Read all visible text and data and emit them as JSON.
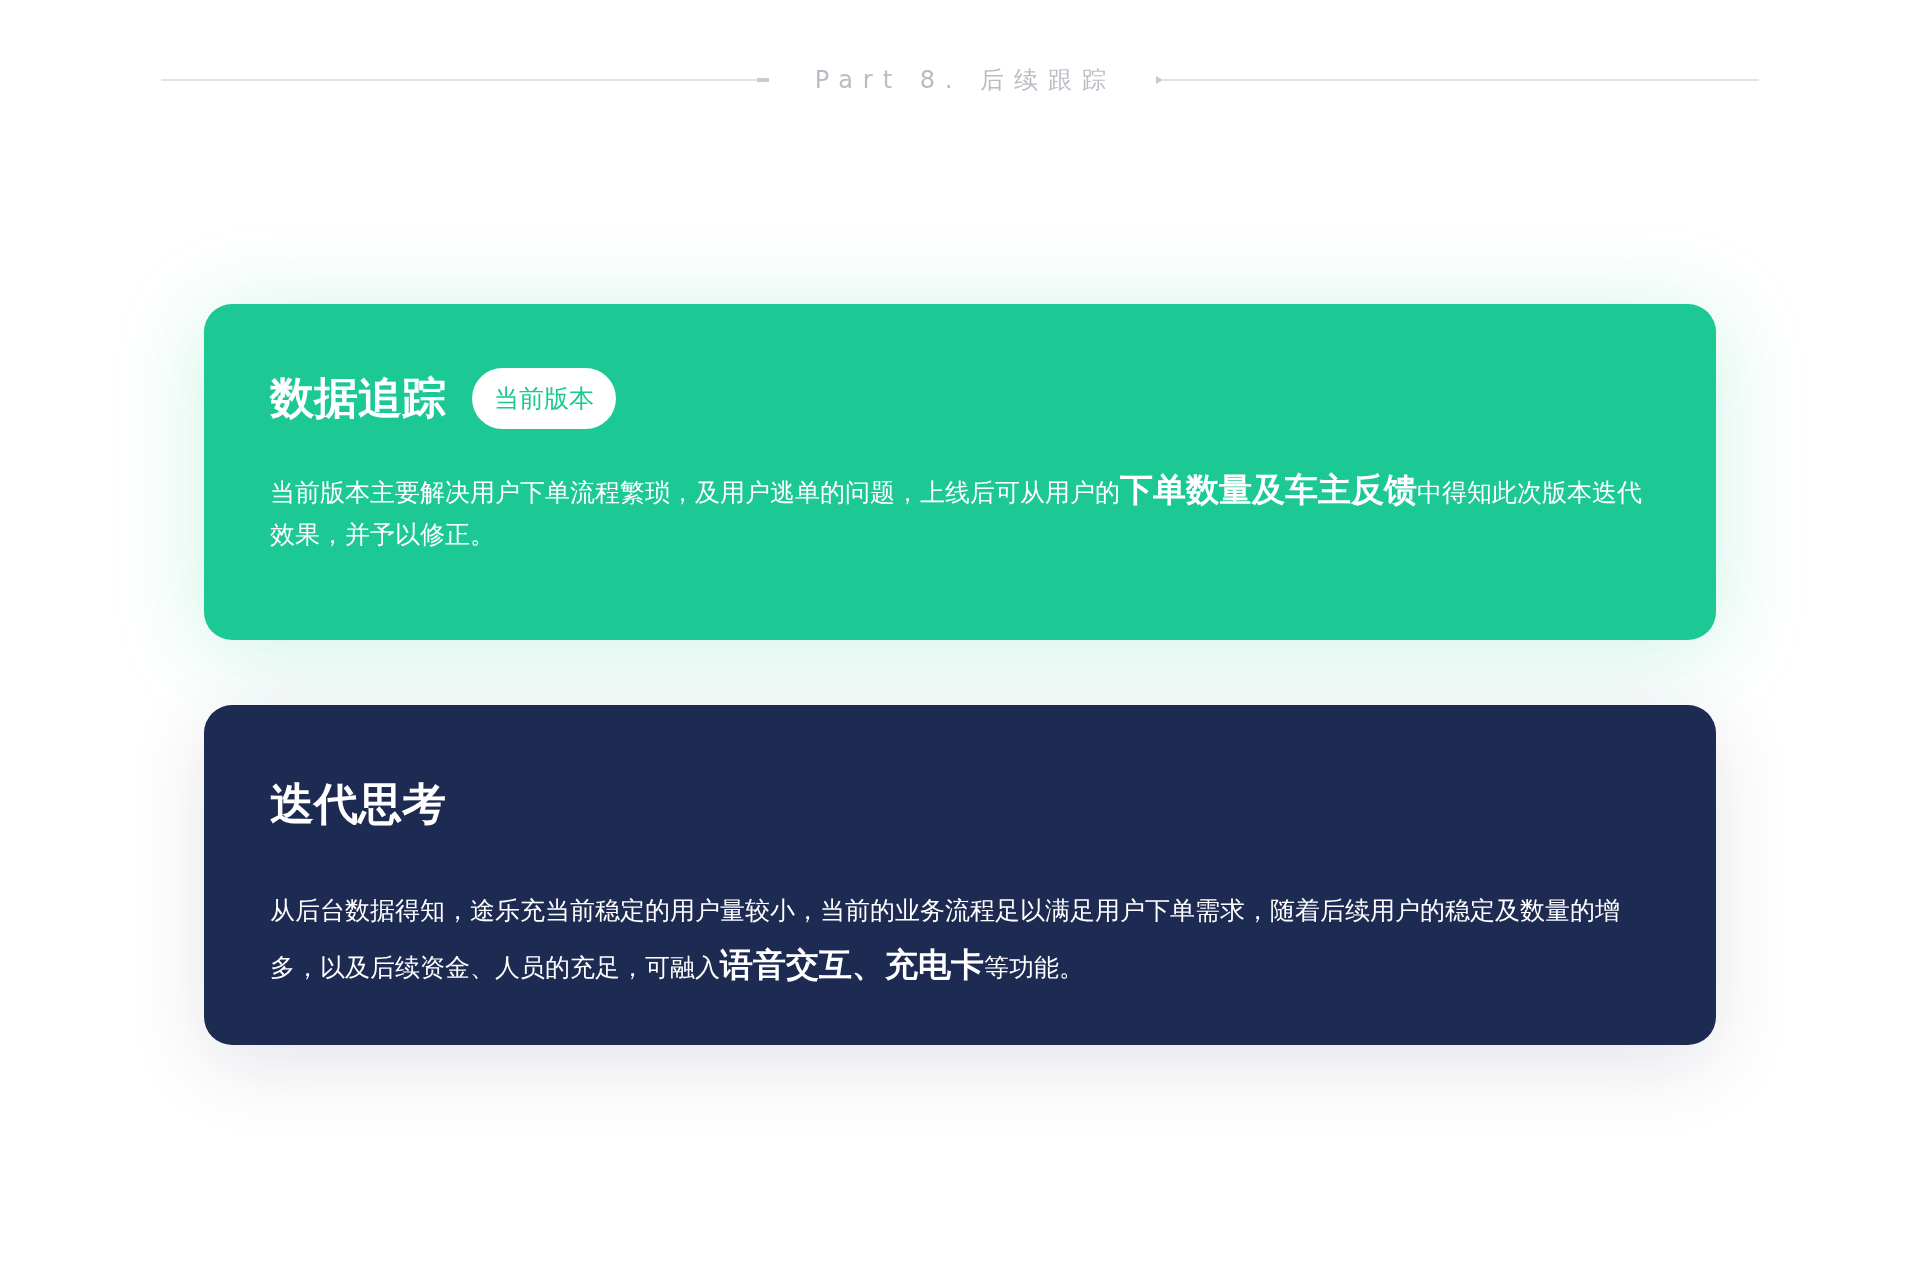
{
  "header": {
    "title": "Part 8. 后续跟踪"
  },
  "cards": [
    {
      "kind": "accent",
      "title": "数据追踪",
      "badge": "当前版本",
      "text": "当前版本主要解决用户下单流程繁琐，及用户逃单的问题，上线后可从用户的**下单数量及车主反馈**中得知此次版本迭代效果，并予以修正。"
    },
    {
      "kind": "dark",
      "title": "迭代思考",
      "text": "从后台数据得知，途乐充当前稳定的用户量较小，当前的业务流程足以满足用户下单需求，随着后续用户的稳定及数量的增多，以及后续资金、人员的充足，可融入**语音交互、充电卡**等功能。"
    }
  ]
}
